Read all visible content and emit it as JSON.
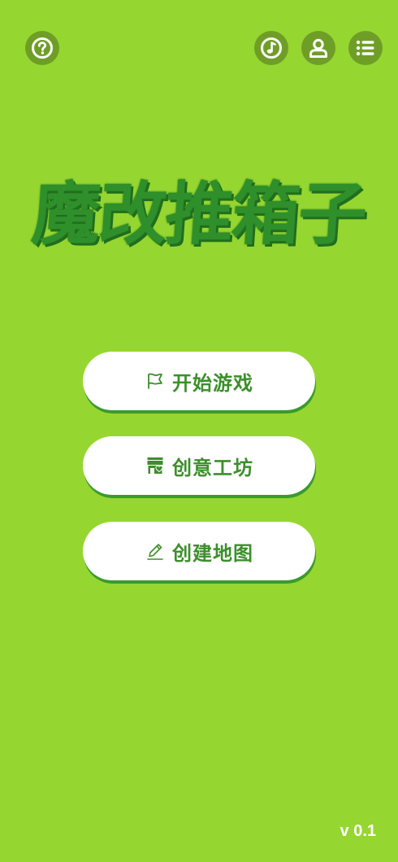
{
  "top_bar": {
    "help_icon": "question-circle-icon",
    "music_icon": "music-note-icon",
    "user_icon": "user-icon",
    "menu_icon": "list-icon"
  },
  "game_title": "魔改推箱子",
  "menu": {
    "start_label": "开始游戏",
    "workshop_label": "创意工坊",
    "create_label": "创建地图",
    "start_icon": "flag-icon",
    "workshop_icon": "shop-icon",
    "create_icon": "pencil-icon"
  },
  "version": "v 0.1",
  "colors": {
    "background": "#96d630",
    "button_circle": "#6f9e27",
    "title": "#2e8f2b",
    "button_text": "#3c8f2b"
  }
}
